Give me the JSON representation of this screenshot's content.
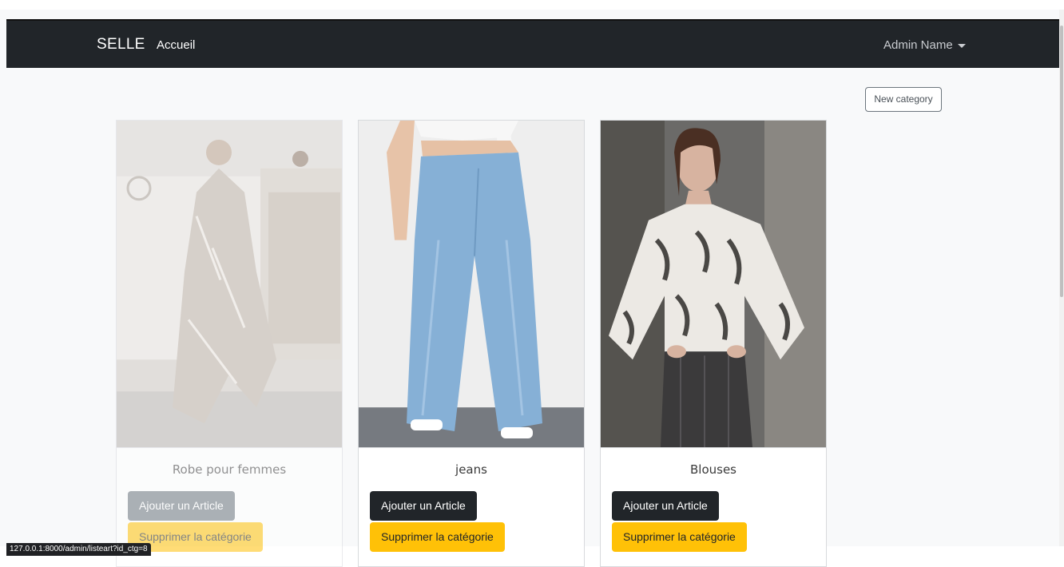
{
  "navbar": {
    "brand": "SELLE",
    "home_link": "Accueil",
    "user_menu": "Admin Name"
  },
  "actions": {
    "new_category": "New category"
  },
  "categories": [
    {
      "title": "Robe pour femmes",
      "add_article": "Ajouter un Article",
      "delete_category": "Supprimer la catégorie"
    },
    {
      "title": "jeans",
      "add_article": "Ajouter un Article",
      "delete_category": "Supprimer la catégorie"
    },
    {
      "title": "Blouses",
      "add_article": "Ajouter un Article",
      "delete_category": "Supprimer la catégorie"
    }
  ],
  "status_bar": {
    "url": "127.0.0.1:8000/admin/listeart?id_ctg=8"
  },
  "colors": {
    "navbar": "#212529",
    "warning": "#ffc107",
    "dark_button": "#212529"
  }
}
